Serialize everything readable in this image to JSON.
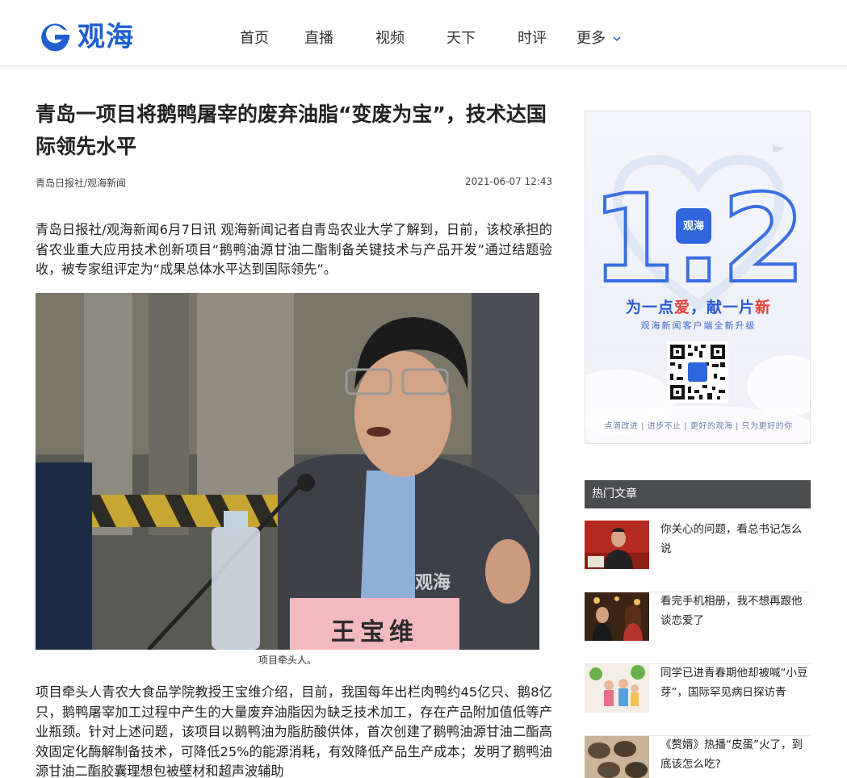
{
  "header": {
    "logo_text": "观海",
    "nav": [
      "首页",
      "直播",
      "视频",
      "天下",
      "时评"
    ],
    "more_label": "更多"
  },
  "article": {
    "title": "青岛一项目将鹅鸭屠宰的废弃油脂“变废为宝”，技术达国际领先水平",
    "source": "青岛日报社/观海新闻",
    "time": "2021-06-07 12:43",
    "paragraphs": [
      "青岛日报社/观海新闻6月7日讯 观海新闻记者自青岛农业大学了解到，日前，该校承担的省农业重大应用技术创新项目“鹅鸭油源甘油二酯制备关键技术与产品开发”通过结题验收，被专家组评定为“成果总体水平达到国际领先”。",
      "项目牵头人青农大食品学院教授王宝维介绍，目前，我国每年出栏肉鸭约45亿只、鹅8亿只，鹅鸭屠宰加工过程中产生的大量废弃油脂因为缺乏技术加工，存在产品附加值低等产业瓶颈。针对上述问题，该项目以鹅鸭油为脂肪酸供体，首次创建了鹅鸭油源甘油二酯高效固定化酶解制备技术，可降低25%的能源消耗，有效降低产品生产成本；发明了鹅鸭油源甘油二酯胶囊理想包被壁材和超声波辅助"
    ],
    "photo_nameplate": "王宝维",
    "photo_watermark": "观海",
    "caption": "项目牵头人。"
  },
  "ad": {
    "big_number": "1.2",
    "app_badge": "观海",
    "slogan_1": "为一点",
    "slogan_2": "爱",
    "slogan_3": "，献一片",
    "slogan_4": "新",
    "subtitle": "观海新闻客户端全新升级",
    "footer": "点滴改进 | 进步不止 | 更好的观海 | 只为更好的你"
  },
  "hot": {
    "heading": "热门文章",
    "items": [
      "你关心的问题，看总书记怎么说",
      "看完手机相册，我不想再跟他谈恋爱了",
      "同学已进青春期他却被喊“小豆芽”，国际罕见病日探访青",
      "《赘婿》热播“皮蛋”火了，到底该怎么吃?"
    ]
  },
  "colors": {
    "brand_blue": "#1f5fcf",
    "hot_header_bg": "#4b4c50"
  }
}
